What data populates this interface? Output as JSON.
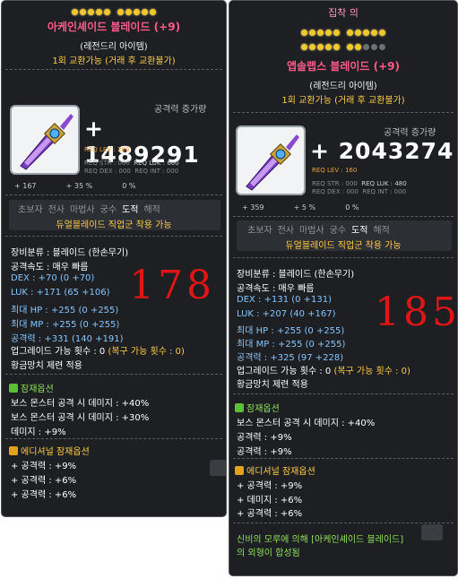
{
  "left": {
    "stars": {
      "filled": 10,
      "total": 10
    },
    "name": "아케인셰이드 블레이드 (+9)",
    "grade": "(레전드리 아이템)",
    "trade": "1회 교환가능 (거래 후 교환불가)",
    "attack_increase_label": "공격력 증가량",
    "attack_increase": "+ 1489291",
    "req_lev": "REQ LEV : 200",
    "req": {
      "str": "REQ STR : 000",
      "luk": "REQ LUK : 600",
      "dex": "REQ DEX : 000",
      "int": "REQ INT : 000"
    },
    "mini": {
      "a": "+ 167",
      "b": "+ 35 %",
      "c": "0 %"
    },
    "jobs": [
      "초보자",
      "전사",
      "마법사",
      "궁수",
      "도적",
      "해적"
    ],
    "job_active": "도적",
    "job_note": "듀얼블레이드 직업군 착용 가능",
    "stats": {
      "category": "장비분류 : 블레이드 (한손무기)",
      "speed": "공격속도 : 매우 빠름",
      "dex": "DEX : +70 (0 +70)",
      "luk": "LUK : +171 (65 +106)",
      "hp": "최대 HP : +255 (0 +255)",
      "mp": "최대 MP : +255 (0 +255)",
      "atk": "공격력 : +331 (140 +191)",
      "upgrade": "업그레이드 가능 횟수 : 0",
      "upgrade_extra": "(복구 가능 횟수 : 0)",
      "hammer": "황금망치 제련 적용"
    },
    "potential_title": "잠재옵션",
    "potential": [
      "보스 몬스터 공격 시 데미지 : +40%",
      "보스 몬스터 공격 시 데미지 : +30%",
      "데미지 : +9%"
    ],
    "additional_title": "에디셔널 잠재옵션",
    "additional": [
      "+ 공격력 : +9%",
      "+ 공격력 : +6%",
      "+ 공격력 : +6%"
    ],
    "handwriting": "178",
    "colors": {
      "name": "#ff5a8a",
      "trade": "#ffcc44",
      "blue": "#86c6ff",
      "handwriting": "#e01616"
    }
  },
  "right": {
    "title": "집착 의",
    "stars_row1": {
      "filled": 10,
      "total": 10
    },
    "stars_row2": {
      "filled": 7,
      "total": 10
    },
    "name": "앱솔랩스 블레이드 (+9)",
    "grade": "(레전드리 아이템)",
    "trade": "1회 교환가능 (거래 후 교환불가)",
    "attack_increase_label": "공격력 증가량",
    "attack_increase": "+ 2043274",
    "req_lev": "REQ LEV : 160",
    "req": {
      "str": "REQ STR : 000",
      "luk": "REQ LUK : 480",
      "dex": "REQ DEX : 000",
      "int": "REQ INT : 000"
    },
    "mini": {
      "a": "+ 359",
      "b": "+ 5 %",
      "c": "0 %"
    },
    "jobs": [
      "초보자",
      "전사",
      "마법사",
      "궁수",
      "도적",
      "해적"
    ],
    "job_active": "도적",
    "job_note": "듀얼블레이드 직업군 착용 가능",
    "stats": {
      "category": "장비분류 : 블레이드 (한손무기)",
      "speed": "공격속도 : 매우 빠름",
      "dex": "DEX : +131 (0 +131)",
      "luk": "LUK : +207 (40 +167)",
      "hp": "최대 HP : +255 (0 +255)",
      "mp": "최대 MP : +255 (0 +255)",
      "atk": "공격력 : +325 (97 +228)",
      "upgrade": "업그레이드 가능 횟수 : 0",
      "upgrade_extra": "(복구 가능 횟수 : 0)",
      "hammer": "황금망치 제련 적용"
    },
    "potential_title": "잠재옵션",
    "potential": [
      "보스 몬스터 공격 시 데미지 : +40%",
      "공격력 : +9%",
      "공격력 : +9%"
    ],
    "additional_title": "에디셔널 잠재옵션",
    "additional": [
      "+ 공격력 : +9%",
      "+ 데미지 : +6%",
      "+ 공격력 : +6%"
    ],
    "fusion_note_1": "신비의 모루에 의해 [아케인셰이드 블레이드]",
    "fusion_note_2": "의 외형이 합성됨",
    "handwriting": "185"
  },
  "icons": [
    "blade-item-icon",
    "potential-badge-icon",
    "additional-badge-icon",
    "cursor-hand-icon"
  ]
}
